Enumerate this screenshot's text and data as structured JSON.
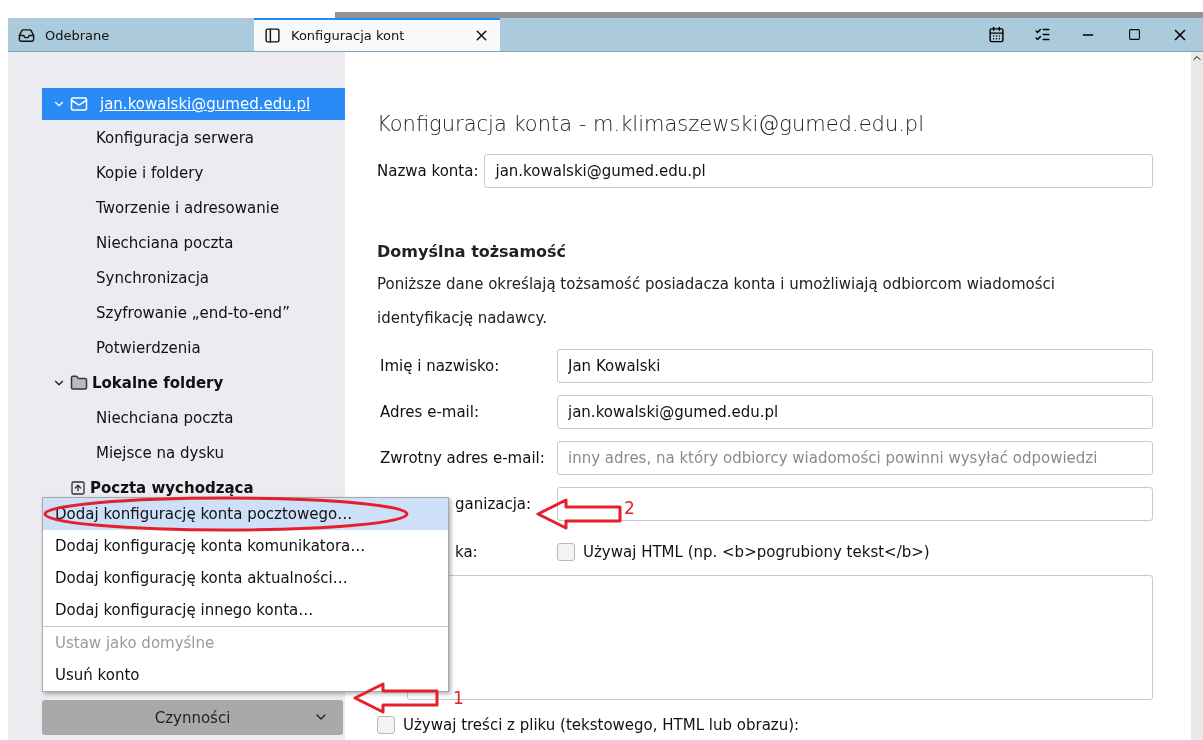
{
  "tabs": [
    {
      "label": "Odebrane",
      "kind": "inbox",
      "selected": false
    },
    {
      "label": "Konfiguracja kont",
      "kind": "settings",
      "selected": true
    }
  ],
  "sidebar": {
    "tree": [
      {
        "label": "jan.kowalski@gumed.edu.pl",
        "kind": "mail",
        "selected": true,
        "expanded": true,
        "children": [
          {
            "label": "Konfiguracja serwera"
          },
          {
            "label": "Kopie i foldery"
          },
          {
            "label": "Tworzenie i adresowanie"
          },
          {
            "label": "Niechciana poczta"
          },
          {
            "label": "Synchronizacja"
          },
          {
            "label": "Szyfrowanie „end-to-end”"
          },
          {
            "label": "Potwierdzenia"
          }
        ]
      },
      {
        "label": "Lokalne foldery",
        "kind": "folder",
        "selected": false,
        "expanded": true,
        "children": [
          {
            "label": "Niechciana poczta"
          },
          {
            "label": "Miejsce na dysku"
          }
        ]
      },
      {
        "label": "Poczta wychodząca",
        "kind": "outbox",
        "selected": false,
        "expanded": false
      }
    ],
    "actions_button": {
      "label": "Czynności"
    }
  },
  "menu": {
    "groups": [
      [
        {
          "label": "Dodaj konfigurację konta pocztowego…",
          "selected": true,
          "disabled": false,
          "circled": true
        },
        {
          "label": "Dodaj konfigurację konta komunikatora…",
          "selected": false,
          "disabled": false,
          "circled": false
        },
        {
          "label": "Dodaj konfigurację konta aktualności…",
          "selected": false,
          "disabled": false,
          "circled": false
        },
        {
          "label": "Dodaj konfigurację innego konta…",
          "selected": false,
          "disabled": false,
          "circled": false
        }
      ],
      [
        {
          "label": "Ustaw jako domyślne",
          "selected": false,
          "disabled": true,
          "circled": false
        },
        {
          "label": "Usuń konto",
          "selected": false,
          "disabled": false,
          "circled": false
        }
      ]
    ]
  },
  "content": {
    "title": "Konfiguracja konta - m.klimaszewski@gumed.edu.pl",
    "account_name": {
      "label": "Nazwa konta:",
      "value": "jan.kowalski@gumed.edu.pl"
    },
    "section_title": "Domyślna tożsamość",
    "description": "Poniższe dane określają tożsamość posiadacza konta i umożliwiają odbiorcom wiadomości identyfikację nadawcy.",
    "fields": [
      {
        "label": "Imię i nazwisko:",
        "value": "Jan Kowalski"
      },
      {
        "label": "Adres e-mail:",
        "value": "jan.kowalski@gumed.edu.pl"
      },
      {
        "label": "Zwrotny adres e-mail:",
        "placeholder": "inny adres, na który odbiorcy wiadomości powinni wysyłać odpowiedzi"
      },
      {
        "label": "ganizacja:",
        "partial": true
      }
    ],
    "signature": {
      "label": "ka:",
      "html_checkbox": {
        "label": "Używaj HTML (np. <b>pogrubiony tekst</b>)",
        "checked": false
      }
    },
    "file_checkbox": {
      "label": "Używaj treści z pliku (tekstowego, HTML lub obrazu):",
      "checked": false
    }
  },
  "annotations": [
    {
      "label": "2"
    },
    {
      "label": "1"
    }
  ]
}
